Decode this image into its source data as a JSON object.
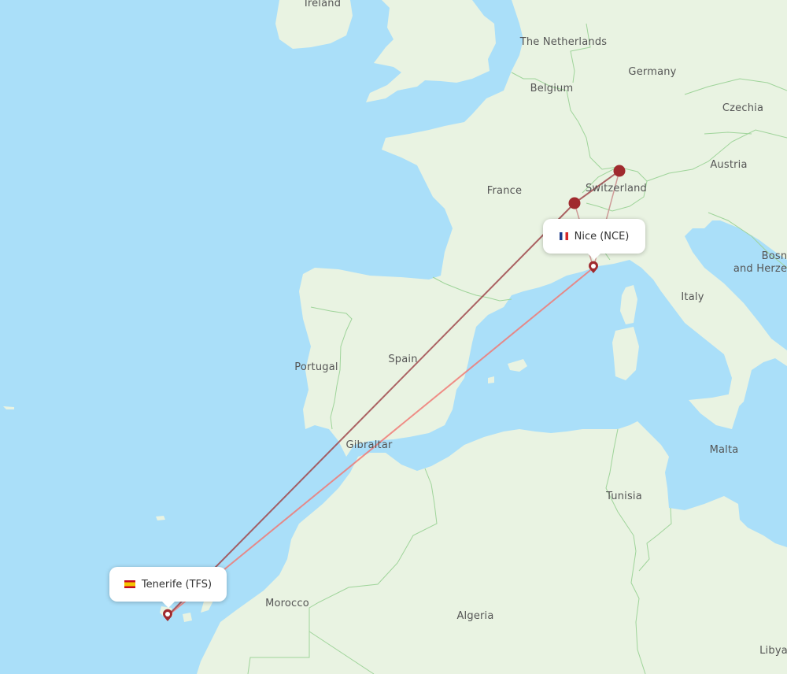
{
  "map": {
    "water_color": "#aadff9",
    "land_color": "#e9f3e2",
    "border_color": "#9fd49a",
    "route_color_dark": "#a0484c",
    "route_color_light": "#f07a76",
    "stop_color": "#a02a2e"
  },
  "airports": {
    "origin": {
      "label": "Nice (NCE)",
      "flag": "france-flag"
    },
    "destination": {
      "label": "Tenerife (TFS)",
      "flag": "spain-flag"
    }
  },
  "connections": [
    {
      "name": "Geneva area stop"
    },
    {
      "name": "Zurich area stop"
    }
  ],
  "routes": [
    {
      "from": "NCE",
      "to": "TFS",
      "type": "direct"
    },
    {
      "from": "NCE",
      "via": "Geneva",
      "to": "TFS",
      "type": "connecting"
    },
    {
      "from": "NCE",
      "via": "Zurich",
      "to": "TFS",
      "type": "connecting"
    }
  ],
  "labels": {
    "ireland": "Ireland",
    "netherlands": "The Netherlands",
    "germany": "Germany",
    "belgium": "Belgium",
    "czechia": "Czechia",
    "france": "France",
    "austria": "Austria",
    "switzerland": "Switzerland",
    "bosnia_line1": "Bosn",
    "bosnia_line2": "and Herze",
    "italy": "Italy",
    "portugal": "Portugal",
    "spain": "Spain",
    "gibraltar": "Gibraltar",
    "malta": "Malta",
    "tunisia": "Tunisia",
    "morocco": "Morocco",
    "algeria": "Algeria",
    "libya": "Libya"
  }
}
